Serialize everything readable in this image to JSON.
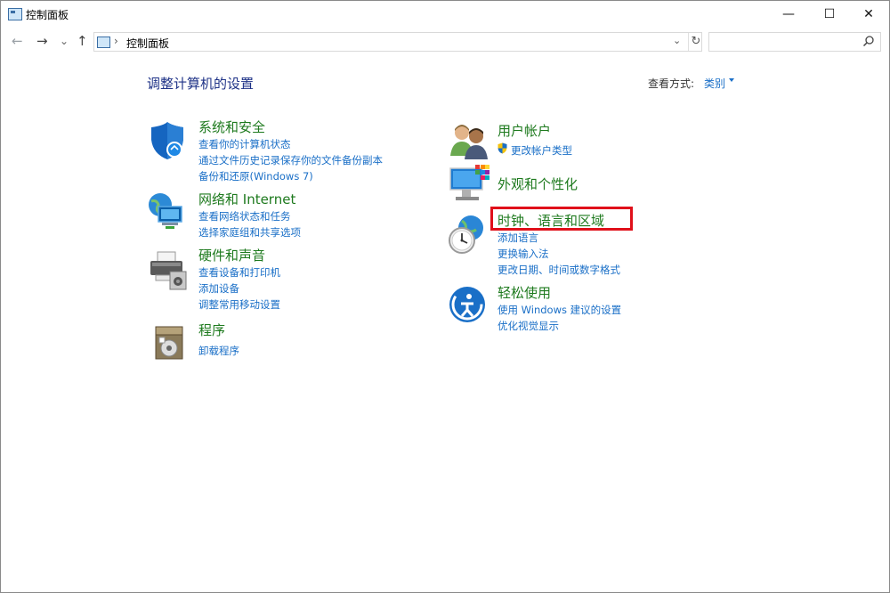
{
  "window": {
    "title": "控制面板",
    "minimize": "—",
    "maximize": "☐",
    "close": "✕"
  },
  "nav": {
    "back": "←",
    "forward": "→",
    "recent": "⌄",
    "up": "↑"
  },
  "address": {
    "separator": "›",
    "crumb": "控制面板",
    "dropdown": "⌄",
    "refresh": "↻"
  },
  "search": {
    "placeholder": "",
    "icon": "search-icon"
  },
  "page": {
    "heading": "调整计算机的设置",
    "view_by_label": "查看方式:",
    "view_by_value": "类别"
  },
  "categories": [
    {
      "title": "系统和安全",
      "icon": "shield-icon",
      "links": [
        "查看你的计算机状态",
        "通过文件历史记录保存你的文件备份副本",
        "备份和还原(Windows 7)"
      ]
    },
    {
      "title": "网络和 Internet",
      "icon": "network-icon",
      "links": [
        "查看网络状态和任务",
        "选择家庭组和共享选项"
      ]
    },
    {
      "title": "硬件和声音",
      "icon": "printer-icon",
      "links": [
        "查看设备和打印机",
        "添加设备",
        "调整常用移动设置"
      ]
    },
    {
      "title": "程序",
      "icon": "programs-icon",
      "links": [
        "卸载程序"
      ]
    },
    {
      "title": "用户帐户",
      "icon": "users-icon",
      "links": [
        "更改帐户类型"
      ]
    },
    {
      "title": "外观和个性化",
      "icon": "display-icon",
      "links": []
    },
    {
      "title": "时钟、语言和区域",
      "icon": "clock-globe-icon",
      "links": [
        "添加语言",
        "更换输入法",
        "更改日期、时间或数字格式"
      ]
    },
    {
      "title": "轻松使用",
      "icon": "ease-of-access-icon",
      "links": [
        "使用 Windows 建议的设置",
        "优化视觉显示"
      ]
    }
  ],
  "colors": {
    "title_green": "#1e7a1e",
    "link_blue": "#1a6fc7",
    "heading_blue": "#1e3287",
    "highlight_red": "#e0101a"
  }
}
